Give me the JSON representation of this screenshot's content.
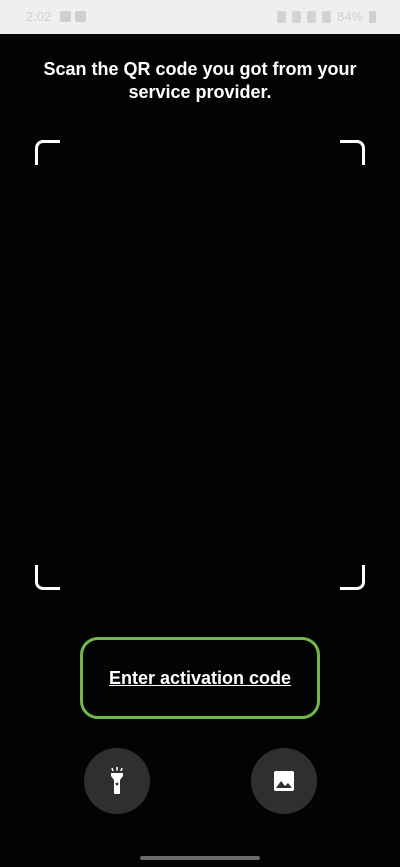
{
  "status_bar": {
    "time": "2:02",
    "battery": "84%",
    "left_icons": [
      "gallery-icon",
      "notification-icon"
    ],
    "right_icons": [
      "battery-saver-icon",
      "mute-icon",
      "wifi-icon",
      "signal-icon",
      "battery-icon"
    ]
  },
  "scanner": {
    "instruction": "Scan the QR code you got from your service provider.",
    "activation_link_label": "Enter activation code",
    "accent_color": "#71b84a"
  },
  "controls": {
    "flashlight_icon": "flashlight-icon",
    "gallery_icon": "image-gallery-icon"
  }
}
